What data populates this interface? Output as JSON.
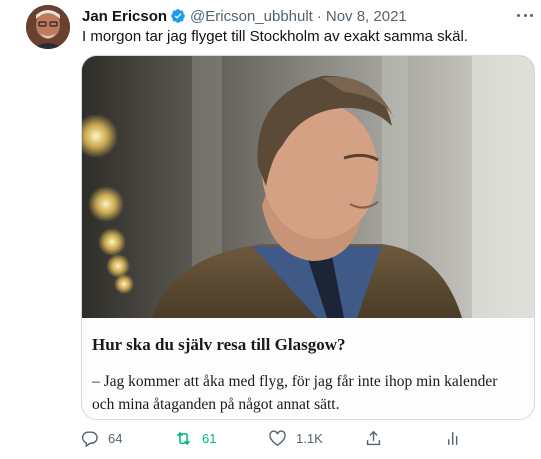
{
  "author": {
    "name": "Jan Ericson",
    "handle": "@Ericson_ubbhult",
    "separator": "·",
    "date": "Nov 8, 2021"
  },
  "tweet": {
    "text": "I morgon tar jag flyget till Stockholm av exakt samma skäl."
  },
  "card": {
    "heading": "Hur ska du själv resa till Glasgow?",
    "paragraph_line1": "– Jag kommer att åka med flyg, för jag får inte ihop min kalender",
    "paragraph_line2": "och mina åtaganden på något annat sätt."
  },
  "actions": {
    "reply_count": "64",
    "retweet_count": "61",
    "like_count": "1.1K"
  },
  "colors": {
    "verified": "#1d9bf0",
    "icon_gray": "#536471",
    "retweet_active": "#00ba7c",
    "border": "#cfd9de"
  },
  "icons": [
    "verified-badge-icon",
    "more-icon",
    "reply-icon",
    "retweet-icon",
    "like-icon",
    "share-icon",
    "analytics-icon"
  ]
}
